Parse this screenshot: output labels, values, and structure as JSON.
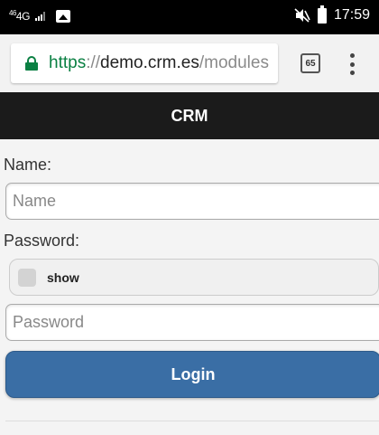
{
  "status_bar": {
    "network": "4G",
    "network_sup": "46",
    "time": "17:59",
    "icons": [
      "signal-icon",
      "gallery-notification-icon",
      "mute-icon",
      "battery-icon"
    ]
  },
  "browser": {
    "url_scheme": "https",
    "url_sep": "://",
    "url_host": "demo.crm.es",
    "url_path": "/modules",
    "tab_count": "65",
    "icons": [
      "lock-icon",
      "tabs-icon",
      "more-menu-icon"
    ]
  },
  "app": {
    "title": "CRM"
  },
  "form": {
    "name_label": "Name:",
    "name_value": "",
    "name_placeholder": "Name",
    "password_label": "Password:",
    "show_label": "show",
    "password_value": "",
    "password_placeholder": "Password",
    "login_label": "Login"
  },
  "colors": {
    "header_bg": "#1b1b1b",
    "login_button": "#3a6ea5",
    "secure_green": "#0b8043"
  }
}
